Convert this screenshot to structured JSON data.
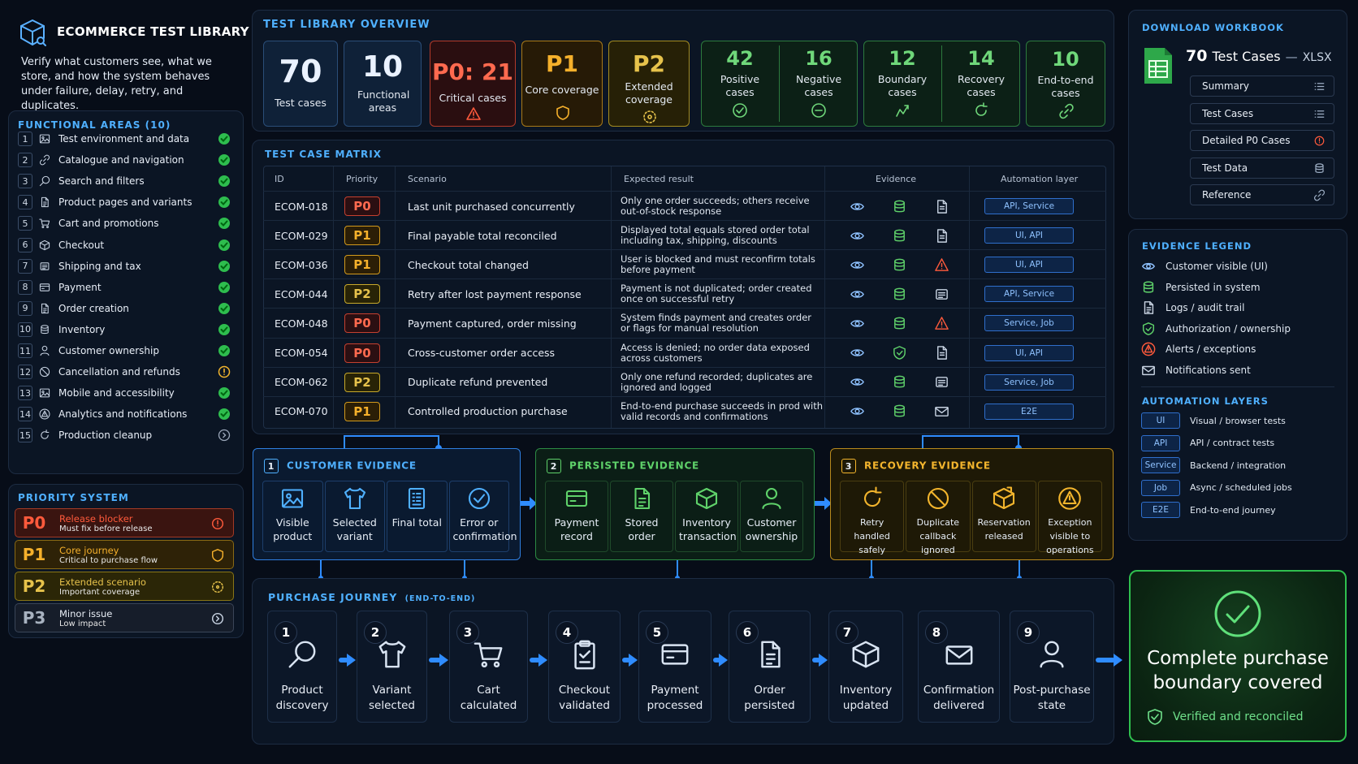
{
  "sidebar": {
    "title": "ECOMMERCE TEST LIBRARY",
    "description": "Verify what customers see, what we store, and how the system behaves under failure, delay, retry, and duplicates.",
    "functional_areas_title": "FUNCTIONAL AREAS (10)",
    "functional_areas": [
      {
        "num": "1",
        "label": "Test environment and data",
        "status": "done"
      },
      {
        "num": "2",
        "label": "Catalogue and navigation",
        "status": "done"
      },
      {
        "num": "3",
        "label": "Search and filters",
        "status": "done"
      },
      {
        "num": "4",
        "label": "Product pages and variants",
        "status": "done"
      },
      {
        "num": "5",
        "label": "Cart and promotions",
        "status": "done"
      },
      {
        "num": "6",
        "label": "Checkout",
        "status": "done"
      },
      {
        "num": "7",
        "label": "Shipping and tax",
        "status": "done"
      },
      {
        "num": "8",
        "label": "Payment",
        "status": "done"
      },
      {
        "num": "9",
        "label": "Order creation",
        "status": "done"
      },
      {
        "num": "10",
        "label": "Inventory",
        "status": "done"
      },
      {
        "num": "11",
        "label": "Customer ownership",
        "status": "done"
      },
      {
        "num": "12",
        "label": "Cancellation and refunds",
        "status": "warning"
      },
      {
        "num": "13",
        "label": "Mobile and accessibility",
        "status": "done"
      },
      {
        "num": "14",
        "label": "Analytics and notifications",
        "status": "done"
      },
      {
        "num": "15",
        "label": "Production cleanup",
        "status": "pending"
      }
    ],
    "priority_title": "PRIORITY SYSTEM",
    "priorities": [
      {
        "code": "P0",
        "title": "Release blocker",
        "subtitle": "Must fix before release",
        "color": "#ff5a3c"
      },
      {
        "code": "P1",
        "title": "Core journey",
        "subtitle": "Critical to purchase flow",
        "color": "#f5b02b"
      },
      {
        "code": "P2",
        "title": "Extended scenario",
        "subtitle": "Important coverage",
        "color": "#e6c24b"
      },
      {
        "code": "P3",
        "title": "Minor issue",
        "subtitle": "Low impact",
        "color": "#a8b2c0"
      }
    ]
  },
  "overview": {
    "title": "TEST LIBRARY OVERVIEW",
    "test_cases": {
      "value": "70",
      "label": "Test cases"
    },
    "functional_areas": {
      "value": "10",
      "label": "Functional areas"
    },
    "critical": {
      "value": "P0: 21",
      "label": "Critical cases"
    },
    "p1": {
      "value": "P1",
      "label": "Core coverage"
    },
    "p2": {
      "value": "P2",
      "label": "Extended coverage"
    },
    "positive": {
      "value": "42",
      "label": "Positive cases"
    },
    "negative": {
      "value": "16",
      "label": "Negative cases"
    },
    "boundary": {
      "value": "12",
      "label": "Boundary cases"
    },
    "recovery": {
      "value": "14",
      "label": "Recovery cases"
    },
    "e2e": {
      "value": "10",
      "label": "End-to-end cases"
    }
  },
  "matrix": {
    "title": "TEST CASE MATRIX",
    "headers": {
      "id": "ID",
      "priority": "Priority",
      "scenario": "Scenario",
      "expected": "Expected result",
      "evidence": "Evidence",
      "layer": "Automation layer"
    },
    "rows": [
      {
        "id": "ECOM-018",
        "priority": "P0",
        "scenario": "Last unit purchased concurrently",
        "expected": "Only one order succeeds; others receive out-of-stock response",
        "evidence": [
          "eye",
          "db",
          "doc"
        ],
        "layer": "API, Service"
      },
      {
        "id": "ECOM-029",
        "priority": "P1",
        "scenario": "Final payable total reconciled",
        "expected": "Displayed total equals stored order total including tax, shipping, discounts",
        "evidence": [
          "eye",
          "db",
          "doc"
        ],
        "layer": "UI, API"
      },
      {
        "id": "ECOM-036",
        "priority": "P1",
        "scenario": "Checkout total changed",
        "expected": "User is blocked and must reconfirm totals before payment",
        "evidence": [
          "eye",
          "db",
          "alert"
        ],
        "layer": "UI, API"
      },
      {
        "id": "ECOM-044",
        "priority": "P2",
        "scenario": "Retry after lost payment response",
        "expected": "Payment is not duplicated; order created once on successful retry",
        "evidence": [
          "eye",
          "db",
          "log"
        ],
        "layer": "API, Service"
      },
      {
        "id": "ECOM-048",
        "priority": "P0",
        "scenario": "Payment captured, order missing",
        "expected": "System finds payment and creates order or flags for manual resolution",
        "evidence": [
          "eye",
          "db",
          "alert"
        ],
        "layer": "Service, Job"
      },
      {
        "id": "ECOM-054",
        "priority": "P0",
        "scenario": "Cross-customer order access",
        "expected": "Access is denied; no order data exposed across customers",
        "evidence": [
          "eye",
          "shield",
          "doc"
        ],
        "layer": "UI, API"
      },
      {
        "id": "ECOM-062",
        "priority": "P2",
        "scenario": "Duplicate refund prevented",
        "expected": "Only one refund recorded; duplicates are ignored and logged",
        "evidence": [
          "eye",
          "db",
          "log"
        ],
        "layer": "Service, Job"
      },
      {
        "id": "ECOM-070",
        "priority": "P1",
        "scenario": "Controlled production purchase",
        "expected": "End-to-end purchase succeeds in prod with valid records and confirmations",
        "evidence": [
          "eye",
          "db",
          "mail"
        ],
        "layer": "E2E"
      }
    ]
  },
  "evidence_groups": [
    {
      "num": "1",
      "title": "CUSTOMER EVIDENCE",
      "color": "#4fb0ff",
      "items": [
        {
          "icon": "image-icon",
          "label": "Visible product"
        },
        {
          "icon": "shirt-icon",
          "label": "Selected variant"
        },
        {
          "icon": "receipt-icon",
          "label": "Final total"
        },
        {
          "icon": "check-circle-icon",
          "label": "Error or confirmation"
        }
      ]
    },
    {
      "num": "2",
      "title": "PERSISTED EVIDENCE",
      "color": "#5fd26a",
      "items": [
        {
          "icon": "card-icon",
          "label": "Payment record"
        },
        {
          "icon": "document-icon",
          "label": "Stored order"
        },
        {
          "icon": "box-icon",
          "label": "Inventory transaction"
        },
        {
          "icon": "user-icon",
          "label": "Customer ownership"
        }
      ]
    },
    {
      "num": "3",
      "title": "RECOVERY EVIDENCE",
      "color": "#f3b52d",
      "items": [
        {
          "icon": "refresh-icon",
          "label": "Retry handled safely"
        },
        {
          "icon": "ban-icon",
          "label": "Duplicate callback ignored"
        },
        {
          "icon": "box-return-icon",
          "label": "Reservation released"
        },
        {
          "icon": "warning-icon",
          "label": "Exception visible to operations"
        }
      ]
    }
  ],
  "journey": {
    "title": "PURCHASE JOURNEY",
    "subtitle": "(END-TO-END)",
    "steps": [
      {
        "num": "1",
        "label": "Product discovery",
        "icon": "search-icon"
      },
      {
        "num": "2",
        "label": "Variant selected",
        "icon": "shirt-icon"
      },
      {
        "num": "3",
        "label": "Cart calculated",
        "icon": "cart-icon"
      },
      {
        "num": "4",
        "label": "Checkout validated",
        "icon": "clipboard-icon"
      },
      {
        "num": "5",
        "label": "Payment processed",
        "icon": "card-icon"
      },
      {
        "num": "6",
        "label": "Order persisted",
        "icon": "document-icon"
      },
      {
        "num": "7",
        "label": "Inventory updated",
        "icon": "box-icon"
      },
      {
        "num": "8",
        "label": "Confirmation delivered",
        "icon": "mail-icon"
      },
      {
        "num": "9",
        "label": "Post-purchase state",
        "icon": "user-icon"
      }
    ]
  },
  "workbook": {
    "title": "DOWNLOAD WORKBOOK",
    "count": "70",
    "count_label": "Test Cases",
    "dash": "—",
    "format": "XLSX",
    "items": [
      {
        "label": "Summary",
        "icon": "list-icon"
      },
      {
        "label": "Test Cases",
        "icon": "list-icon"
      },
      {
        "label": "Detailed P0 Cases",
        "icon": "alert-icon"
      },
      {
        "label": "Test Data",
        "icon": "database-icon"
      },
      {
        "label": "Reference",
        "icon": "link-icon"
      }
    ]
  },
  "legend": {
    "title": "EVIDENCE LEGEND",
    "items": [
      {
        "icon": "eye-icon",
        "label": "Customer visible (UI)",
        "color": "#8fc2ff"
      },
      {
        "icon": "database-icon",
        "label": "Persisted in system",
        "color": "#5fd26a"
      },
      {
        "icon": "document-icon",
        "label": "Logs / audit trail",
        "color": "#c8d3e2"
      },
      {
        "icon": "shield-icon",
        "label": "Authorization / ownership",
        "color": "#5fd26a"
      },
      {
        "icon": "warning-icon",
        "label": "Alerts / exceptions",
        "color": "#ff5a3c"
      },
      {
        "icon": "mail-icon",
        "label": "Notifications sent",
        "color": "#c8d3e2"
      }
    ]
  },
  "automation_layers": {
    "title": "AUTOMATION LAYERS",
    "items": [
      {
        "badge": "UI",
        "label": "Visual / browser tests"
      },
      {
        "badge": "API",
        "label": "API / contract tests"
      },
      {
        "badge": "Service",
        "label": "Backend / integration"
      },
      {
        "badge": "Job",
        "label": "Async / scheduled jobs"
      },
      {
        "badge": "E2E",
        "label": "End-to-end journey"
      }
    ]
  },
  "completion": {
    "title": "Complete purchase boundary covered",
    "subtitle": "Verified and reconciled"
  }
}
